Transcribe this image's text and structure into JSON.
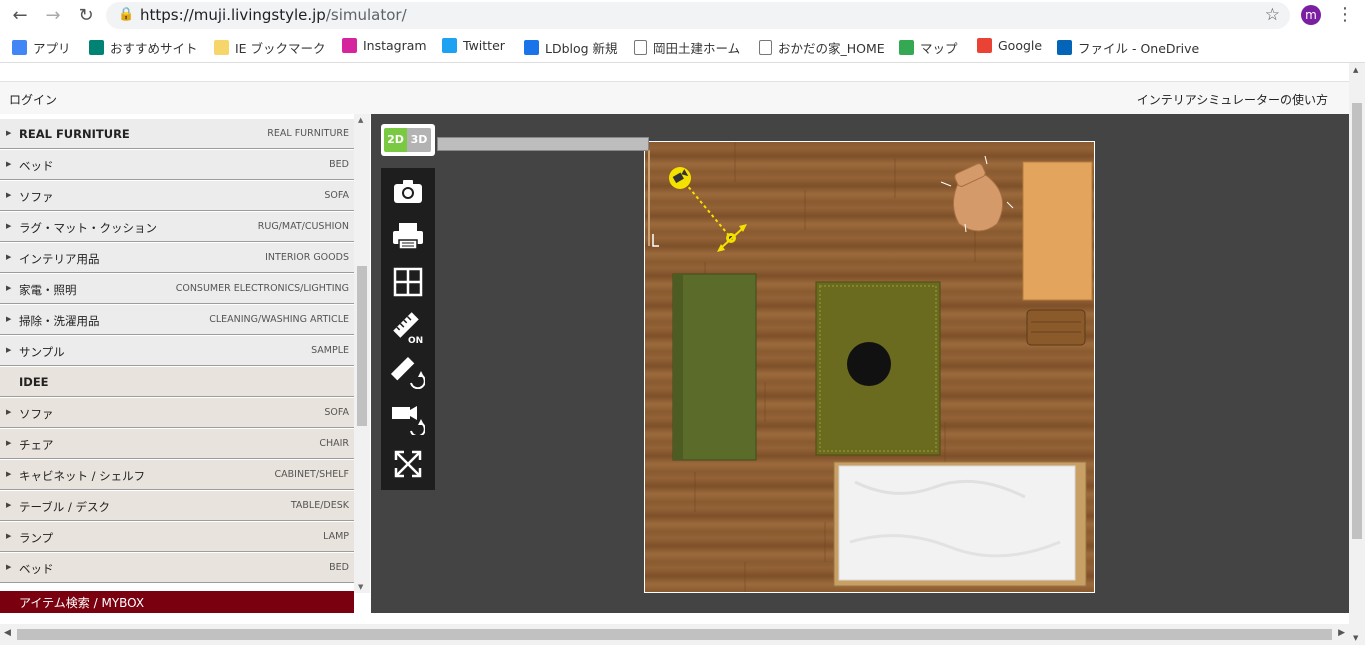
{
  "browser": {
    "url_host": "https://muji.livingstyle.jp",
    "url_path": "/simulator/",
    "profile_initial": "m",
    "bookmarks": [
      {
        "label": "アプリ",
        "icon": "apps-grid-icon",
        "color": "#4285f4"
      },
      {
        "label": "おすすめサイト",
        "icon": "bing-icon",
        "color": "#008373"
      },
      {
        "label": "IE ブックマーク",
        "icon": "folder-icon",
        "color": "#f6d56b"
      },
      {
        "label": "Instagram",
        "icon": "instagram-icon",
        "color": "#d6249f"
      },
      {
        "label": "Twitter",
        "icon": "twitter-icon",
        "color": "#1da1f2"
      },
      {
        "label": "LDblog 新規",
        "icon": "ldblog-icon",
        "color": "#1a73e8"
      },
      {
        "label": "岡田土建ホーム",
        "icon": "page-icon",
        "color": "#ffffff"
      },
      {
        "label": "おかだの家_HOME",
        "icon": "page-icon",
        "color": "#ffffff"
      },
      {
        "label": "マップ",
        "icon": "maps-icon",
        "color": "#34a853"
      },
      {
        "label": "Google",
        "icon": "google-icon",
        "color": "#ea4335"
      },
      {
        "label": "ファイル - OneDrive",
        "icon": "onedrive-icon",
        "color": "#0364b8"
      }
    ]
  },
  "header": {
    "login": "ログイン",
    "howto": "インテリアシミュレーターの使い方"
  },
  "sidebar": {
    "categories": [
      {
        "jp": "REAL FURNITURE",
        "en": "REAL FURNITURE",
        "style": "grey",
        "arrow": true,
        "head": true
      },
      {
        "jp": "ベッド",
        "en": "BED",
        "style": "grey",
        "arrow": true
      },
      {
        "jp": "ソファ",
        "en": "SOFA",
        "style": "grey",
        "arrow": true
      },
      {
        "jp": "ラグ・マット・クッション",
        "en": "RUG/MAT/CUSHION",
        "style": "grey",
        "arrow": true
      },
      {
        "jp": "インテリア用品",
        "en": "INTERIOR GOODS",
        "style": "grey",
        "arrow": true
      },
      {
        "jp": "家電・照明",
        "en": "CONSUMER ELECTRONICS/LIGHTING",
        "style": "grey",
        "arrow": true
      },
      {
        "jp": "掃除・洗濯用品",
        "en": "CLEANING/WASHING ARTICLE",
        "style": "grey",
        "arrow": true
      },
      {
        "jp": "サンプル",
        "en": "SAMPLE",
        "style": "grey",
        "arrow": true
      },
      {
        "jp": "IDEE",
        "en": "",
        "style": "beige",
        "arrow": false,
        "head": true
      },
      {
        "jp": "ソファ",
        "en": "SOFA",
        "style": "beige",
        "arrow": true
      },
      {
        "jp": "チェア",
        "en": "CHAIR",
        "style": "beige",
        "arrow": true
      },
      {
        "jp": "キャビネット / シェルフ",
        "en": "CABINET/SHELF",
        "style": "beige",
        "arrow": true
      },
      {
        "jp": "テーブル / デスク",
        "en": "TABLE/DESK",
        "style": "beige",
        "arrow": true
      },
      {
        "jp": "ランプ",
        "en": "LAMP",
        "style": "beige",
        "arrow": true
      },
      {
        "jp": "ベッド",
        "en": "BED",
        "style": "beige",
        "arrow": true
      }
    ],
    "item_search": "アイテム検索 / MYBOX"
  },
  "viewer": {
    "mode_2d": "2D",
    "mode_3d": "3D",
    "active_mode": "2D",
    "tools": [
      {
        "name": "camera-icon"
      },
      {
        "name": "print-icon"
      },
      {
        "name": "grid-icon"
      },
      {
        "name": "ruler-on-icon",
        "label": "ON"
      },
      {
        "name": "ruler-rotate-icon"
      },
      {
        "name": "camera-rotate-icon"
      },
      {
        "name": "fullscreen-icon"
      }
    ]
  },
  "colors": {
    "accent_green": "#7ac943",
    "search_bar": "#7a0010",
    "canvas_bg": "#444444",
    "sofa": "#5b6b2a",
    "rug": "#6b6b1f"
  }
}
